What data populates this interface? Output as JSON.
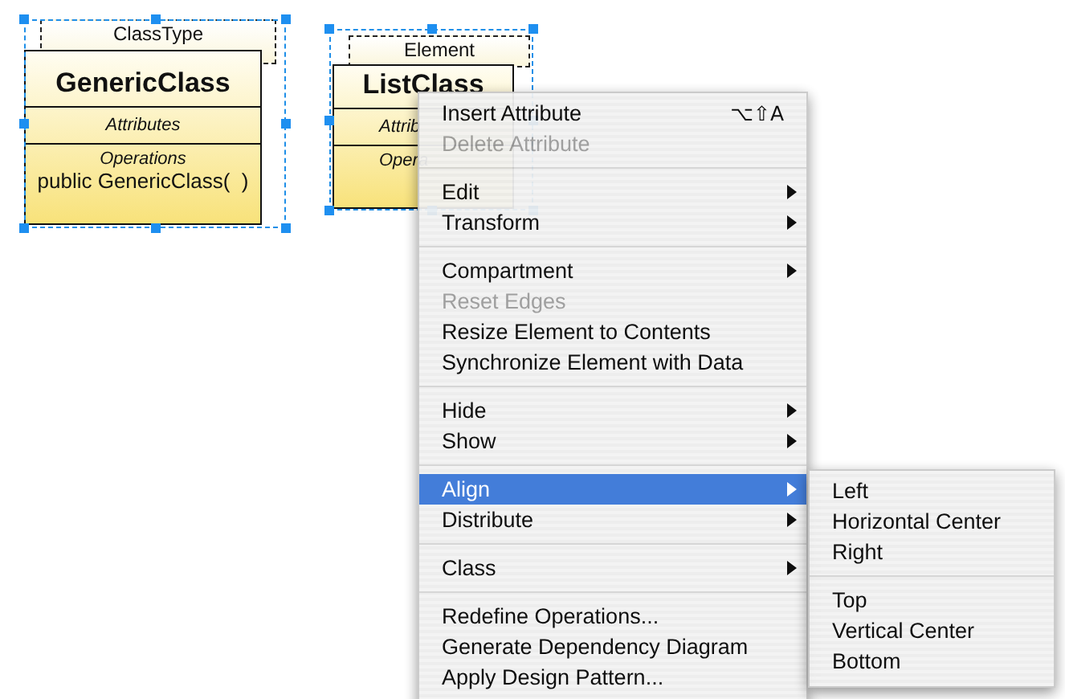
{
  "diagram": {
    "classes": [
      {
        "stereotype": "ClassType",
        "name": "GenericClass",
        "attributes_label": "Attributes",
        "operations_label": "Operations",
        "operations": [
          "public GenericClass(  )"
        ],
        "selected": true
      },
      {
        "stereotype": "Element",
        "name": "ListClass",
        "attributes_label": "Attrib",
        "operations_label": "Opera",
        "selected": true
      }
    ]
  },
  "context_menu": {
    "items": [
      {
        "kind": "item",
        "label": "Insert Attribute",
        "shortcut": "⌥⇧A",
        "disabled": false,
        "submenu": false,
        "selected": false
      },
      {
        "kind": "item",
        "label": "Delete Attribute",
        "disabled": true,
        "submenu": false,
        "selected": false
      },
      {
        "kind": "separator"
      },
      {
        "kind": "item",
        "label": "Edit",
        "disabled": false,
        "submenu": true,
        "selected": false
      },
      {
        "kind": "item",
        "label": "Transform",
        "disabled": false,
        "submenu": true,
        "selected": false
      },
      {
        "kind": "separator"
      },
      {
        "kind": "item",
        "label": "Compartment",
        "disabled": false,
        "submenu": true,
        "selected": false
      },
      {
        "kind": "item",
        "label": "Reset Edges",
        "disabled": true,
        "submenu": false,
        "selected": false
      },
      {
        "kind": "item",
        "label": "Resize Element to Contents",
        "disabled": false,
        "submenu": false,
        "selected": false
      },
      {
        "kind": "item",
        "label": "Synchronize Element with Data",
        "disabled": false,
        "submenu": false,
        "selected": false
      },
      {
        "kind": "separator"
      },
      {
        "kind": "item",
        "label": "Hide",
        "disabled": false,
        "submenu": true,
        "selected": false
      },
      {
        "kind": "item",
        "label": "Show",
        "disabled": false,
        "submenu": true,
        "selected": false
      },
      {
        "kind": "separator"
      },
      {
        "kind": "item",
        "label": "Align",
        "disabled": false,
        "submenu": true,
        "selected": true,
        "submenu_items": [
          {
            "kind": "item",
            "label": "Left",
            "disabled": false,
            "submenu": false,
            "selected": false
          },
          {
            "kind": "item",
            "label": "Horizontal Center",
            "disabled": false,
            "submenu": false,
            "selected": false
          },
          {
            "kind": "item",
            "label": "Right",
            "disabled": false,
            "submenu": false,
            "selected": false
          },
          {
            "kind": "separator"
          },
          {
            "kind": "item",
            "label": "Top",
            "disabled": false,
            "submenu": false,
            "selected": false
          },
          {
            "kind": "item",
            "label": "Vertical Center",
            "disabled": false,
            "submenu": false,
            "selected": false
          },
          {
            "kind": "item",
            "label": "Bottom",
            "disabled": false,
            "submenu": false,
            "selected": false
          }
        ]
      },
      {
        "kind": "item",
        "label": "Distribute",
        "disabled": false,
        "submenu": true,
        "selected": false
      },
      {
        "kind": "separator"
      },
      {
        "kind": "item",
        "label": "Class",
        "disabled": false,
        "submenu": true,
        "selected": false
      },
      {
        "kind": "separator"
      },
      {
        "kind": "item",
        "label": "Redefine Operations...",
        "disabled": false,
        "submenu": false,
        "selected": false
      },
      {
        "kind": "item",
        "label": "Generate Dependency Diagram",
        "disabled": false,
        "submenu": false,
        "selected": false
      },
      {
        "kind": "item",
        "label": "Apply Design Pattern...",
        "disabled": false,
        "submenu": false,
        "selected": false
      }
    ]
  }
}
